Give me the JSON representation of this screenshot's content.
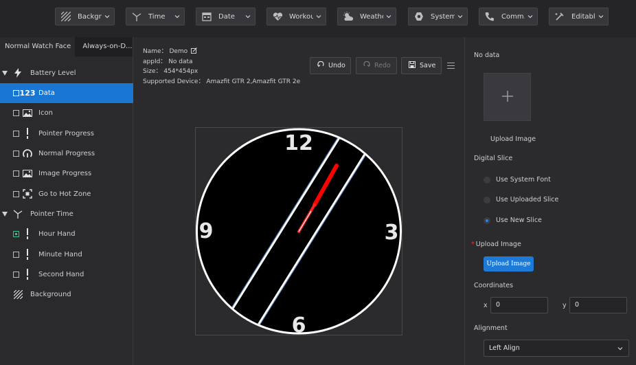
{
  "toolbar": {
    "items": [
      {
        "label": "Backgro...",
        "icon": "background-icon"
      },
      {
        "label": "Time",
        "icon": "clock-hands-icon"
      },
      {
        "label": "Date",
        "icon": "calendar-icon"
      },
      {
        "label": "Workou...",
        "icon": "heart-icon"
      },
      {
        "label": "Weather",
        "icon": "weather-icon"
      },
      {
        "label": "System",
        "icon": "system-icon"
      },
      {
        "label": "Comm...",
        "icon": "phone-icon"
      },
      {
        "label": "Editable",
        "icon": "edit-tool-icon"
      }
    ]
  },
  "sidebar": {
    "tabs": [
      "Normal Watch Face",
      "Always-on-D..."
    ],
    "tree": [
      {
        "label": "Battery Level",
        "type": "group",
        "icon": "lightning-icon"
      },
      {
        "label": "Data",
        "type": "item",
        "icon": "digits-icon",
        "icon_text": "123",
        "selected": true,
        "checked": false
      },
      {
        "label": "Icon",
        "type": "item",
        "icon": "image-icon",
        "checked": false
      },
      {
        "label": "Pointer Progress",
        "type": "item",
        "icon": "pointer-icon",
        "checked": false
      },
      {
        "label": "Normal Progress",
        "type": "item",
        "icon": "arc-progress-icon",
        "checked": false
      },
      {
        "label": "Image Progress",
        "type": "item",
        "icon": "image-icon",
        "checked": false
      },
      {
        "label": "Go to Hot Zone",
        "type": "item",
        "icon": "hot-zone-icon",
        "checked": false
      },
      {
        "label": "Pointer Time",
        "type": "group",
        "icon": "clock-hands-icon"
      },
      {
        "label": "Hour Hand",
        "type": "item",
        "icon": "pointer-icon",
        "checked": true
      },
      {
        "label": "Minute Hand",
        "type": "item",
        "icon": "pointer-icon",
        "checked": false
      },
      {
        "label": "Second Hand",
        "type": "item",
        "icon": "pointer-icon",
        "checked": false
      },
      {
        "label": "Background",
        "type": "root",
        "icon": "background-icon"
      }
    ]
  },
  "project": {
    "name_label": "Name：",
    "name": "Demo",
    "appid_label": "appId：",
    "appid": "No data",
    "size_label": "Size：",
    "size": "454*454px",
    "device_label": "Supported Device：",
    "device": "Amazfit GTR 2,Amazfit GTR 2e"
  },
  "actions": {
    "undo": "Undo",
    "redo": "Redo",
    "save": "Save"
  },
  "watch": {
    "numerals": {
      "top": "12",
      "right": "3",
      "bottom": "6",
      "left": "9"
    }
  },
  "props": {
    "no_data": "No data",
    "upload_image_caption": "Upload Image",
    "digital_slice_label": "Digital Slice",
    "options": [
      "Use System Font",
      "Use Uploaded Slice",
      "Use New Slice"
    ],
    "selected_option": 2,
    "upload_image_label": "Upload Image",
    "required_mark": "*",
    "upload_button": "Upload Image",
    "coordinates_label": "Coordinates",
    "x_label": "x",
    "x_value": "0",
    "y_label": "y",
    "y_value": "0",
    "alignment_label": "Alignment",
    "alignment_value": "Left Align"
  },
  "colors": {
    "accent": "#1976d2",
    "selected_row": "#1976d2",
    "progress": "#ff0000"
  }
}
